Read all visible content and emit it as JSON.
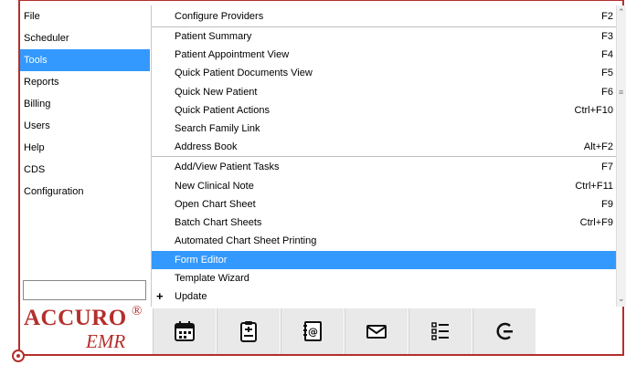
{
  "left_menu": {
    "items": [
      {
        "label": "File",
        "active": false
      },
      {
        "label": "Scheduler",
        "active": false
      },
      {
        "label": "Tools",
        "active": true
      },
      {
        "label": "Reports",
        "active": false
      },
      {
        "label": "Billing",
        "active": false
      },
      {
        "label": "Users",
        "active": false
      },
      {
        "label": "Help",
        "active": false
      },
      {
        "label": "CDS",
        "active": false
      },
      {
        "label": "Configuration",
        "active": false
      }
    ],
    "search_value": ""
  },
  "logo": {
    "brand": "ACCURO",
    "registered": "®",
    "sub": "EMR"
  },
  "submenu": {
    "items": [
      {
        "label": "Configure Providers",
        "shortcut": "F2"
      },
      {
        "label": "Patient Summary",
        "shortcut": "F3"
      },
      {
        "label": "Patient Appointment View",
        "shortcut": "F4"
      },
      {
        "label": "Quick Patient Documents View",
        "shortcut": "F5"
      },
      {
        "label": "Quick New Patient",
        "shortcut": "F6"
      },
      {
        "label": "Quick Patient Actions",
        "shortcut": "Ctrl+F10"
      },
      {
        "label": "Search Family Link",
        "shortcut": ""
      },
      {
        "label": "Address Book",
        "shortcut": "Alt+F2"
      },
      {
        "label": "Add/View Patient Tasks",
        "shortcut": "F7"
      },
      {
        "label": "New Clinical Note",
        "shortcut": "Ctrl+F11"
      },
      {
        "label": "Open Chart Sheet",
        "shortcut": "F9"
      },
      {
        "label": "Batch Chart Sheets",
        "shortcut": "Ctrl+F9"
      },
      {
        "label": "Automated Chart Sheet Printing",
        "shortcut": ""
      },
      {
        "label": "Form Editor",
        "shortcut": ""
      },
      {
        "label": "Template Wizard",
        "shortcut": ""
      },
      {
        "label": "Update",
        "shortcut": ""
      }
    ],
    "active_item": "Form Editor",
    "expandable_item": "Update"
  },
  "toolbar": {
    "buttons": [
      {
        "icon": "calendar-icon"
      },
      {
        "icon": "clipboard-icon"
      },
      {
        "icon": "address-book-icon"
      },
      {
        "icon": "envelope-icon"
      },
      {
        "icon": "task-list-icon"
      },
      {
        "icon": "logout-icon"
      }
    ]
  },
  "colors": {
    "brand_red": "#b42f2c",
    "selection_blue": "#3399ff",
    "toolbar_bg": "#e9e9e9"
  }
}
